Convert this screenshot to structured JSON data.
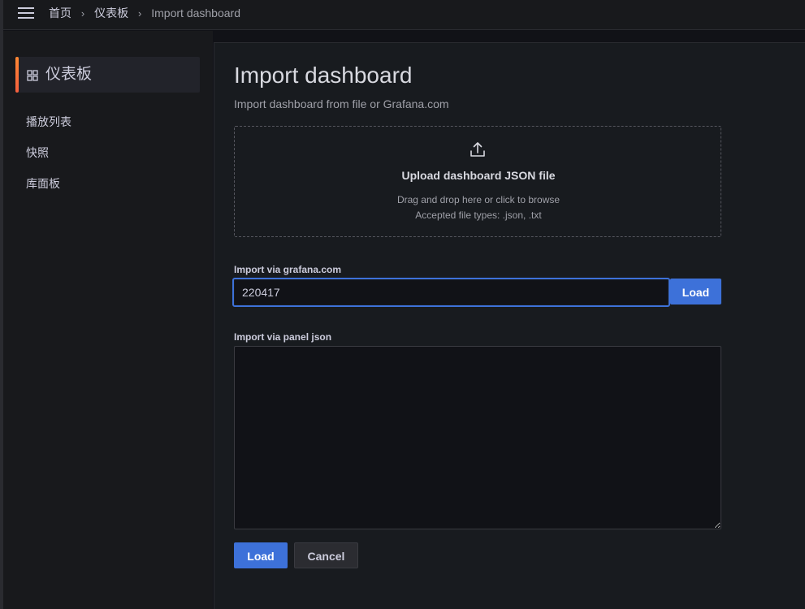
{
  "breadcrumb": {
    "home": "首页",
    "dashboards": "仪表板",
    "current": "Import dashboard"
  },
  "sidebar": {
    "active": {
      "label": "仪表板",
      "icon": "grid-icon"
    },
    "items": [
      {
        "label": "播放列表"
      },
      {
        "label": "快照"
      },
      {
        "label": "库面板"
      }
    ]
  },
  "page": {
    "title": "Import dashboard",
    "subtitle": "Import dashboard from file or Grafana.com"
  },
  "upload": {
    "icon": "upload-icon",
    "title": "Upload dashboard JSON file",
    "hint": "Drag and drop here or click to browse",
    "accepted": "Accepted file types: .json, .txt"
  },
  "gcom": {
    "label": "Import via grafana.com",
    "value": "220417",
    "load_label": "Load"
  },
  "panel_json": {
    "label": "Import via panel json",
    "value": ""
  },
  "actions": {
    "load_label": "Load",
    "cancel_label": "Cancel"
  },
  "colors": {
    "accent": "#3d71d9",
    "active_bar": "#ff8833",
    "background": "#111217"
  }
}
